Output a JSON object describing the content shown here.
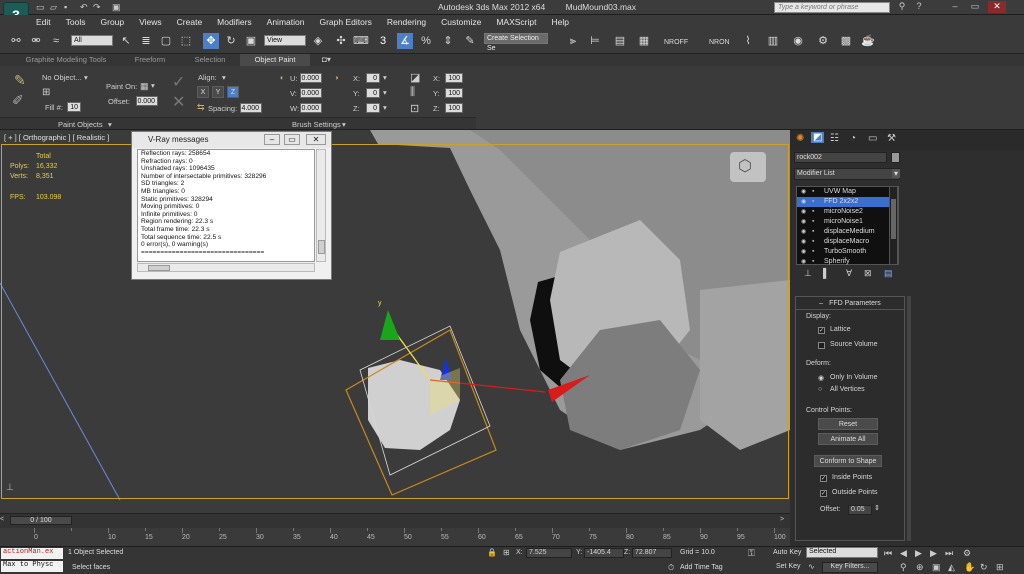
{
  "app": {
    "title": "Autodesk 3ds Max  2012 x64",
    "file": "MudMound03.max",
    "search_placeholder": "Type a keyword or phrase",
    "logo": "3"
  },
  "menu": [
    "Edit",
    "Tools",
    "Group",
    "Views",
    "Create",
    "Modifiers",
    "Animation",
    "Graph Editors",
    "Rendering",
    "Customize",
    "MAXScript",
    "Help"
  ],
  "toolbar": {
    "filter": "All",
    "ref_coord": "View",
    "selection_set": "Create Selection Se",
    "nroff": "NROFF",
    "nron": "NRON",
    "snap_label": "3"
  },
  "ribbon": {
    "tabs": [
      "Graphite Modeling Tools",
      "Freeform",
      "Selection",
      "Object Paint"
    ],
    "active_tab": "Object Paint",
    "no_object": "No Object...",
    "paint_on": "Paint On:",
    "fill": "Fill #:",
    "fill_val": "10",
    "offset": "Offset:",
    "offset_val": "0.000",
    "align": "Align:",
    "spacing": "Spacing:",
    "spacing_val": "4.000",
    "xyz": [
      "X",
      "Y",
      "Z"
    ],
    "u": "U:",
    "v": "V:",
    "w": "W:",
    "uvw_val": "0.000",
    "x": "X:",
    "y": "Y:",
    "z": "Z:",
    "xyz_val": "0",
    "pct_val": "100",
    "group_objects": "Paint Objects",
    "group_brush": "Brush Settings"
  },
  "viewport": {
    "label": "[ + ] [ Orthographic ] [ Realistic ]",
    "stats_header": "Total",
    "polys_label": "Polys:",
    "polys": "16,332",
    "verts_label": "Verts:",
    "verts": "8,351",
    "fps_label": "FPS:",
    "fps": "103.098",
    "axis_y": "y"
  },
  "vray": {
    "title": "V-Ray messages",
    "lines": [
      "Reflection rays: 258654",
      "Refraction rays: 0",
      "Unshaded rays: 1096435",
      "Number of intersectable primitives: 328296",
      "SD triangles: 2",
      "MB triangles: 0",
      "Static primitives: 328294",
      "Moving primitives: 0",
      "Infinite primitives: 0",
      "Region rendering: 22.3 s",
      "Total frame time: 22.3 s",
      "Total sequence time: 22.5 s",
      "0 error(s), 0 warning(s)",
      "================================"
    ]
  },
  "command_panel": {
    "object_name": "rock002",
    "modifier_list": "Modifier List",
    "modifiers": [
      "UVW Map",
      "FFD 2x2x2",
      "microNoise2",
      "microNoise1",
      "displaceMedium",
      "displaceMacro",
      "TurboSmooth",
      "Spherify"
    ],
    "selected_modifier": "FFD 2x2x2",
    "rollout_title": "FFD Parameters",
    "display_label": "Display:",
    "lattice": "Lattice",
    "source_volume": "Source Volume",
    "deform_label": "Deform:",
    "only_in_volume": "Only In Volume",
    "all_vertices": "All Vertices",
    "control_points_label": "Control Points:",
    "reset": "Reset",
    "animate_all": "Animate All",
    "conform": "Conform to Shape",
    "inside_points": "Inside Points",
    "outside_points": "Outside Points",
    "offset_label": "Offset:",
    "offset_val": "0.05"
  },
  "timeline": {
    "frame": "0 / 100",
    "ticks": [
      "0",
      "10",
      "15",
      "20",
      "25",
      "30",
      "35",
      "40",
      "45",
      "50",
      "55",
      "60",
      "65",
      "70",
      "75",
      "80",
      "85",
      "90",
      "95",
      "100"
    ]
  },
  "status": {
    "script1": "actionMan.ex",
    "script2": "Max to Physc",
    "selected": "1 Object Selected",
    "prompt": "Select faces",
    "x_label": "X:",
    "x": "7.525",
    "y_label": "Y:",
    "y": "-1405.4",
    "z_label": "Z:",
    "z": "72.807",
    "grid": "Grid = 10.0",
    "add_time_tag": "Add Time Tag",
    "auto_key": "Auto Key",
    "set_key": "Set Key",
    "key_mode": "Selected",
    "key_filters": "Key Filters..."
  },
  "colors": {
    "selection": "#c9a227",
    "gizmo_x": "#d81c1c",
    "gizmo_y": "#1aa51a",
    "gizmo_z": "#1733d6",
    "modifier_highlight": "#3a6fcf"
  }
}
